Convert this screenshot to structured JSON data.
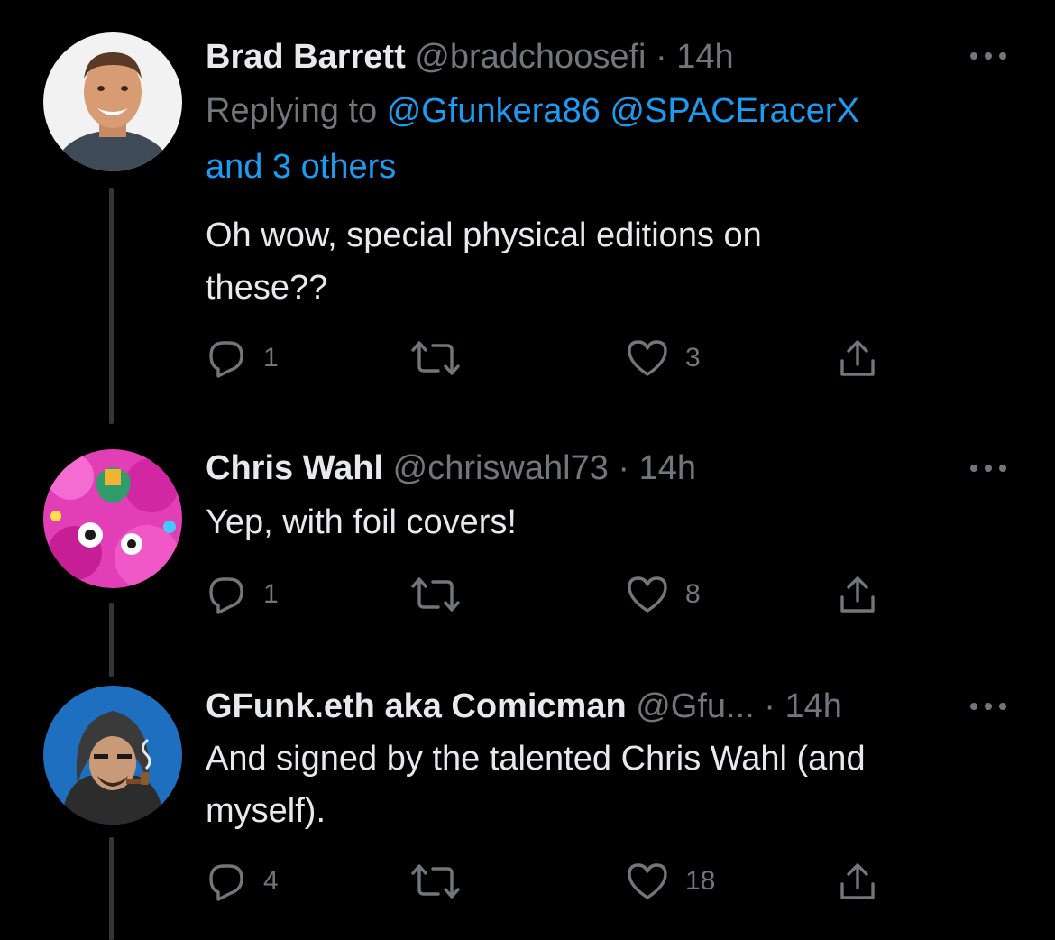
{
  "tweets": [
    {
      "name": "Brad Barrett",
      "handle": "@bradchoosefi",
      "separator": "·",
      "time": "14h",
      "replying_prefix": "Replying to",
      "replying_mentions": [
        "@Gfunkera86",
        "@SPACEracerX"
      ],
      "replying_suffix": "and 3 others",
      "text_lines": [
        "Oh wow, special physical editions on",
        "these??"
      ],
      "replies": "1",
      "retweets": "",
      "likes": "3",
      "avatar_icon": "person-photo"
    },
    {
      "name": "Chris Wahl",
      "handle": "@chriswahl73",
      "separator": "·",
      "time": "14h",
      "text_lines": [
        "Yep, with foil covers!"
      ],
      "replies": "1",
      "retweets": "",
      "likes": "8",
      "avatar_icon": "pink-illustration"
    },
    {
      "name": "GFunk.eth aka Comicman",
      "handle": "@Gfu...",
      "separator": "·",
      "time": "14h",
      "text_lines": [
        "And signed by the talented Chris Wahl (and",
        "myself)."
      ],
      "replies": "4",
      "retweets": "",
      "likes": "18",
      "avatar_icon": "hooded-cartoon"
    }
  ],
  "icons": {
    "reply": "reply-icon",
    "retweet": "retweet-icon",
    "like": "heart-icon",
    "share": "share-icon",
    "more": "more-icon"
  },
  "colors": {
    "background": "#000000",
    "primary_text": "#e7e9ea",
    "secondary_text": "#71767b",
    "link": "#1d9bf0",
    "thread_line": "#333639"
  }
}
